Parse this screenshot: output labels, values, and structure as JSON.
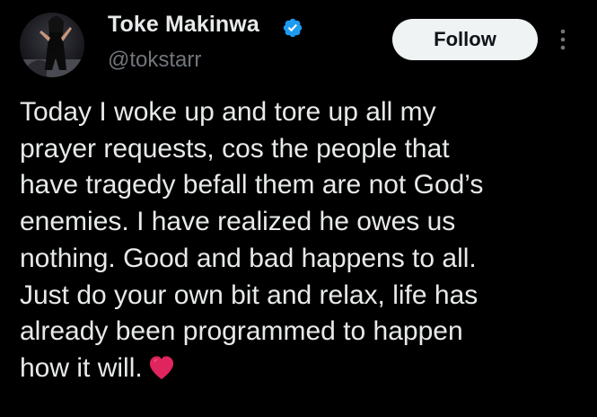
{
  "tweet": {
    "author": {
      "display_name": "Toke Makinwa",
      "handle": "@tokstarr",
      "verified_icon": "verified-badge-icon",
      "verified_color": "#1d9bf0",
      "avatar_icon": "avatar"
    },
    "follow_button": {
      "label": "Follow"
    },
    "more_icon": "more-vertical-icon",
    "text_lines": [
      "Today I woke up and tore up all my",
      "prayer requests, cos the people that",
      "have tragedy befall them are not God’s",
      "enemies.  I have realized he owes us",
      "nothing. Good and bad happens to all.",
      "Just do your own bit and relax, life has",
      "already been programmed to happen",
      "how it will."
    ],
    "trailing_emoji": "red-heart-icon",
    "colors": {
      "background": "#000000",
      "text": "#e7e9ea",
      "secondary_text": "#71767b",
      "follow_bg": "#eff3f4",
      "heart": "#e0245e"
    }
  }
}
